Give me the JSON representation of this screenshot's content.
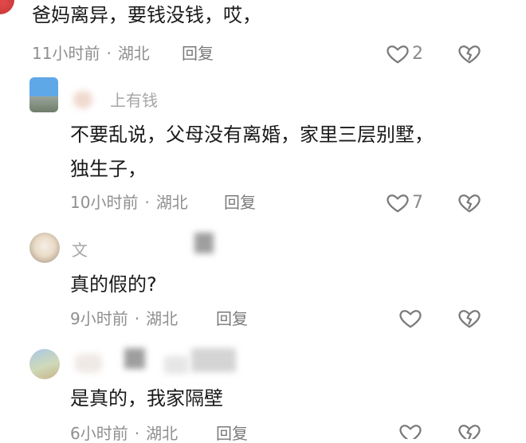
{
  "comments": [
    {
      "text": "爸妈离异，要钱没钱，哎，",
      "time": "11小时前",
      "location": "湖北",
      "likes": "2"
    },
    {
      "username": "上有钱",
      "text_line1": "不要乱说，父母没有离婚，家里三层别墅，",
      "text_line2": "独生子，",
      "time": "10小时前",
      "location": "湖北",
      "likes": "7"
    },
    {
      "username": "文",
      "text": "真的假的?",
      "time": "9小时前",
      "location": "湖北"
    },
    {
      "text": "是真的，我家隔壁",
      "time": "6小时前",
      "location": "湖北"
    }
  ],
  "labels": {
    "reply": "回复",
    "dot": "·"
  },
  "icons": {
    "like": "heart-outline-icon",
    "dislike": "broken-heart-icon"
  },
  "colors": {
    "text": "#1a1a1a",
    "meta": "#8f8f8f",
    "icon": "#7a7a7a"
  }
}
